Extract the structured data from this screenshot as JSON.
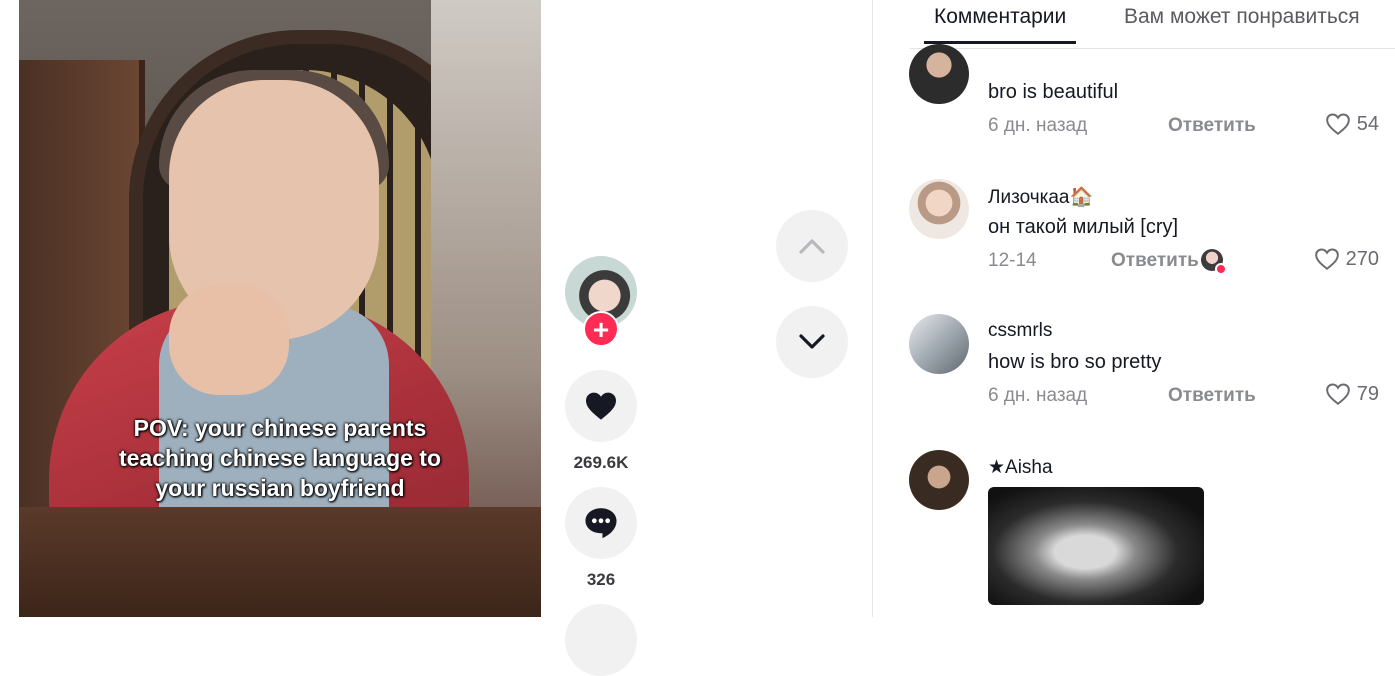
{
  "video": {
    "caption_lines": [
      "POV: your chinese parents",
      "teaching chinese language to",
      "your russian boyfriend"
    ]
  },
  "actions": {
    "follow_symbol": "+",
    "likes_count": "269.6K",
    "comments_count": "326",
    "like_icon": "heart-icon",
    "comment_icon": "speech-bubble-icon"
  },
  "navigation": {
    "up_icon": "chevron-up-icon",
    "down_icon": "chevron-down-icon"
  },
  "tabs": [
    {
      "label": "Комментарии",
      "active": true
    },
    {
      "label": "Вам может понравиться",
      "active": false
    }
  ],
  "comments": [
    {
      "username": "",
      "text": "bro is beautiful",
      "time": "6 дн. назад",
      "reply": "Ответить",
      "likes": "54"
    },
    {
      "username": "Лизочкаа🏠",
      "text": "он такой милый [cry]",
      "time": "12-14",
      "reply": "Ответить",
      "likes": "270",
      "creator_liked": true
    },
    {
      "username": "cssmrls",
      "text": "how is bro so pretty",
      "time": "6 дн. назад",
      "reply": "Ответить",
      "likes": "79"
    },
    {
      "username": "★Aisha",
      "has_image": true
    }
  ],
  "colors": {
    "accent": "#fe2c55",
    "text_primary": "#161823",
    "text_secondary": "#8a8b91",
    "button_bg": "#f1f1f2"
  }
}
